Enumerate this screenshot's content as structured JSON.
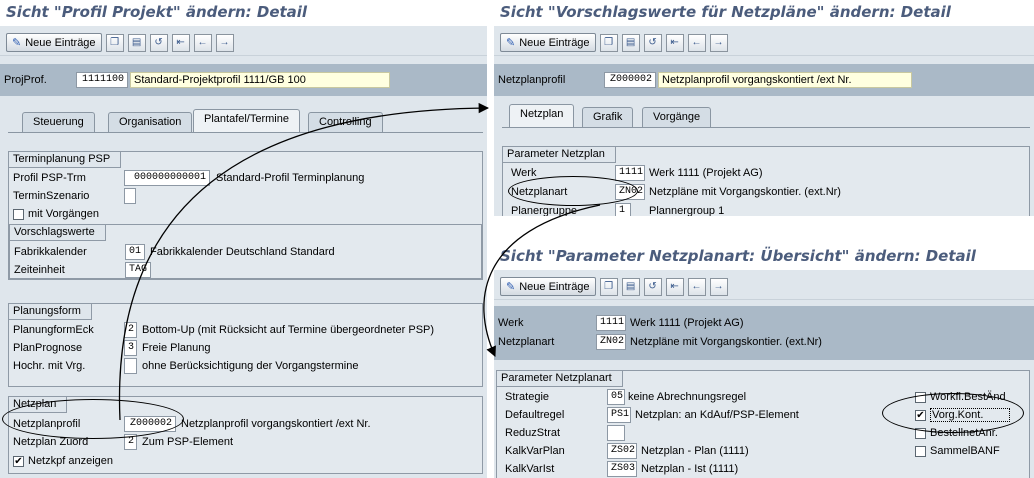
{
  "toolbar": {
    "new_entries": "Neue Einträge"
  },
  "panel1": {
    "title": "Sicht \"Profil Projekt\" ändern: Detail",
    "header": {
      "label": "ProjProf.",
      "value": "1111100",
      "description": "Standard-Projektprofil 1111/GB 100"
    },
    "tabs": [
      "Steuerung",
      "Organisation",
      "Plantafel/Termine",
      "Controlling"
    ],
    "g1": {
      "title": "Terminplanung PSP",
      "profil_label": "Profil PSP-Trm",
      "profil_value": "000000000001",
      "profil_desc": "Standard-Profil Terminplanung",
      "szen_label": "TerminSzenario",
      "mitvorg_label": "mit Vorgängen",
      "sub_title": "Vorschlagswerte",
      "fabrik_label": "Fabrikkalender",
      "fabrik_value": "01",
      "fabrik_desc": "Fabrikkalender Deutschland Standard",
      "zeit_label": "Zeiteinheit",
      "zeit_value": "TAG"
    },
    "g2": {
      "title": "Planungsform",
      "r1_label": "PlanungformEck",
      "r1_value": "2",
      "r1_desc": "Bottom-Up (mit Rücksicht auf Termine übergeordneter PSP)",
      "r2_label": "PlanPrognose",
      "r2_value": "3",
      "r2_desc": "Freie Planung",
      "r3_label": "Hochr. mit Vrg.",
      "r3_desc": "ohne Berücksichtigung der Vorgangstermine"
    },
    "g3": {
      "title": "Netzplan",
      "r1_label": "Netzplanprofil",
      "r1_value": "Z000002",
      "r1_desc": "Netzplanprofil vorgangskontiert /ext Nr.",
      "r2_label": "Netzplan Zuord",
      "r2_value": "2",
      "r2_desc": "Zum PSP-Element",
      "cb_label": "Netzkpf anzeigen",
      "cb_mark": "✔"
    }
  },
  "panel2": {
    "title": "Sicht \"Vorschlagswerte für Netzpläne\" ändern: Detail",
    "header": {
      "label": "Netzplanprofil",
      "value": "Z000002",
      "description": "Netzplanprofil vorgangskontiert /ext Nr."
    },
    "tabs": [
      "Netzplan",
      "Grafik",
      "Vorgänge"
    ],
    "group_title": "Parameter Netzplan",
    "r1_label": "Werk",
    "r1_value": "1111",
    "r1_desc": "Werk 1111 (Projekt AG)",
    "r2_label": "Netzplanart",
    "r2_value": "ZN02",
    "r2_desc": "Netzpläne mit Vorgangskontier. (ext.Nr)",
    "r3_label": "Planergruppe",
    "r3_value": "1",
    "r3_desc": "Plannergroup 1"
  },
  "panel3": {
    "title": "Sicht \"Parameter Netzplanart: Übersicht\" ändern: Detail",
    "h1_label": "Werk",
    "h1_value": "1111",
    "h1_desc": "Werk 1111 (Projekt AG)",
    "h2_label": "Netzplanart",
    "h2_value": "ZN02",
    "h2_desc": "Netzpläne mit Vorgangskontier. (ext.Nr)",
    "group_title": "Parameter Netzplanart",
    "r1_label": "Strategie",
    "r1_value": "05",
    "r1_desc": "keine Abrechnungsregel",
    "r2_label": "Defaultregel",
    "r2_value": "PS1",
    "r2_desc": "Netzplan: an KdAuf/PSP-Element",
    "r3_label": "ReduzStrat",
    "r4_label": "KalkVarPlan",
    "r4_value": "ZS02",
    "r4_desc": "Netzplan - Plan (1111)",
    "r5_label": "KalkVarIst",
    "r5_value": "ZS03",
    "r5_desc": "Netzplan - Ist (1111)",
    "cb1_label": "Workfl.BestÄnd",
    "cb2_label": "Vorg.Kont.",
    "cb2_mark": "✔",
    "cb3_label": "BestellnetAnr.",
    "cb4_label": "SammelBANF"
  },
  "colors": {
    "title": "#4b5c7c",
    "background": "#dfe6ec",
    "header_band": "#aab9c7"
  }
}
